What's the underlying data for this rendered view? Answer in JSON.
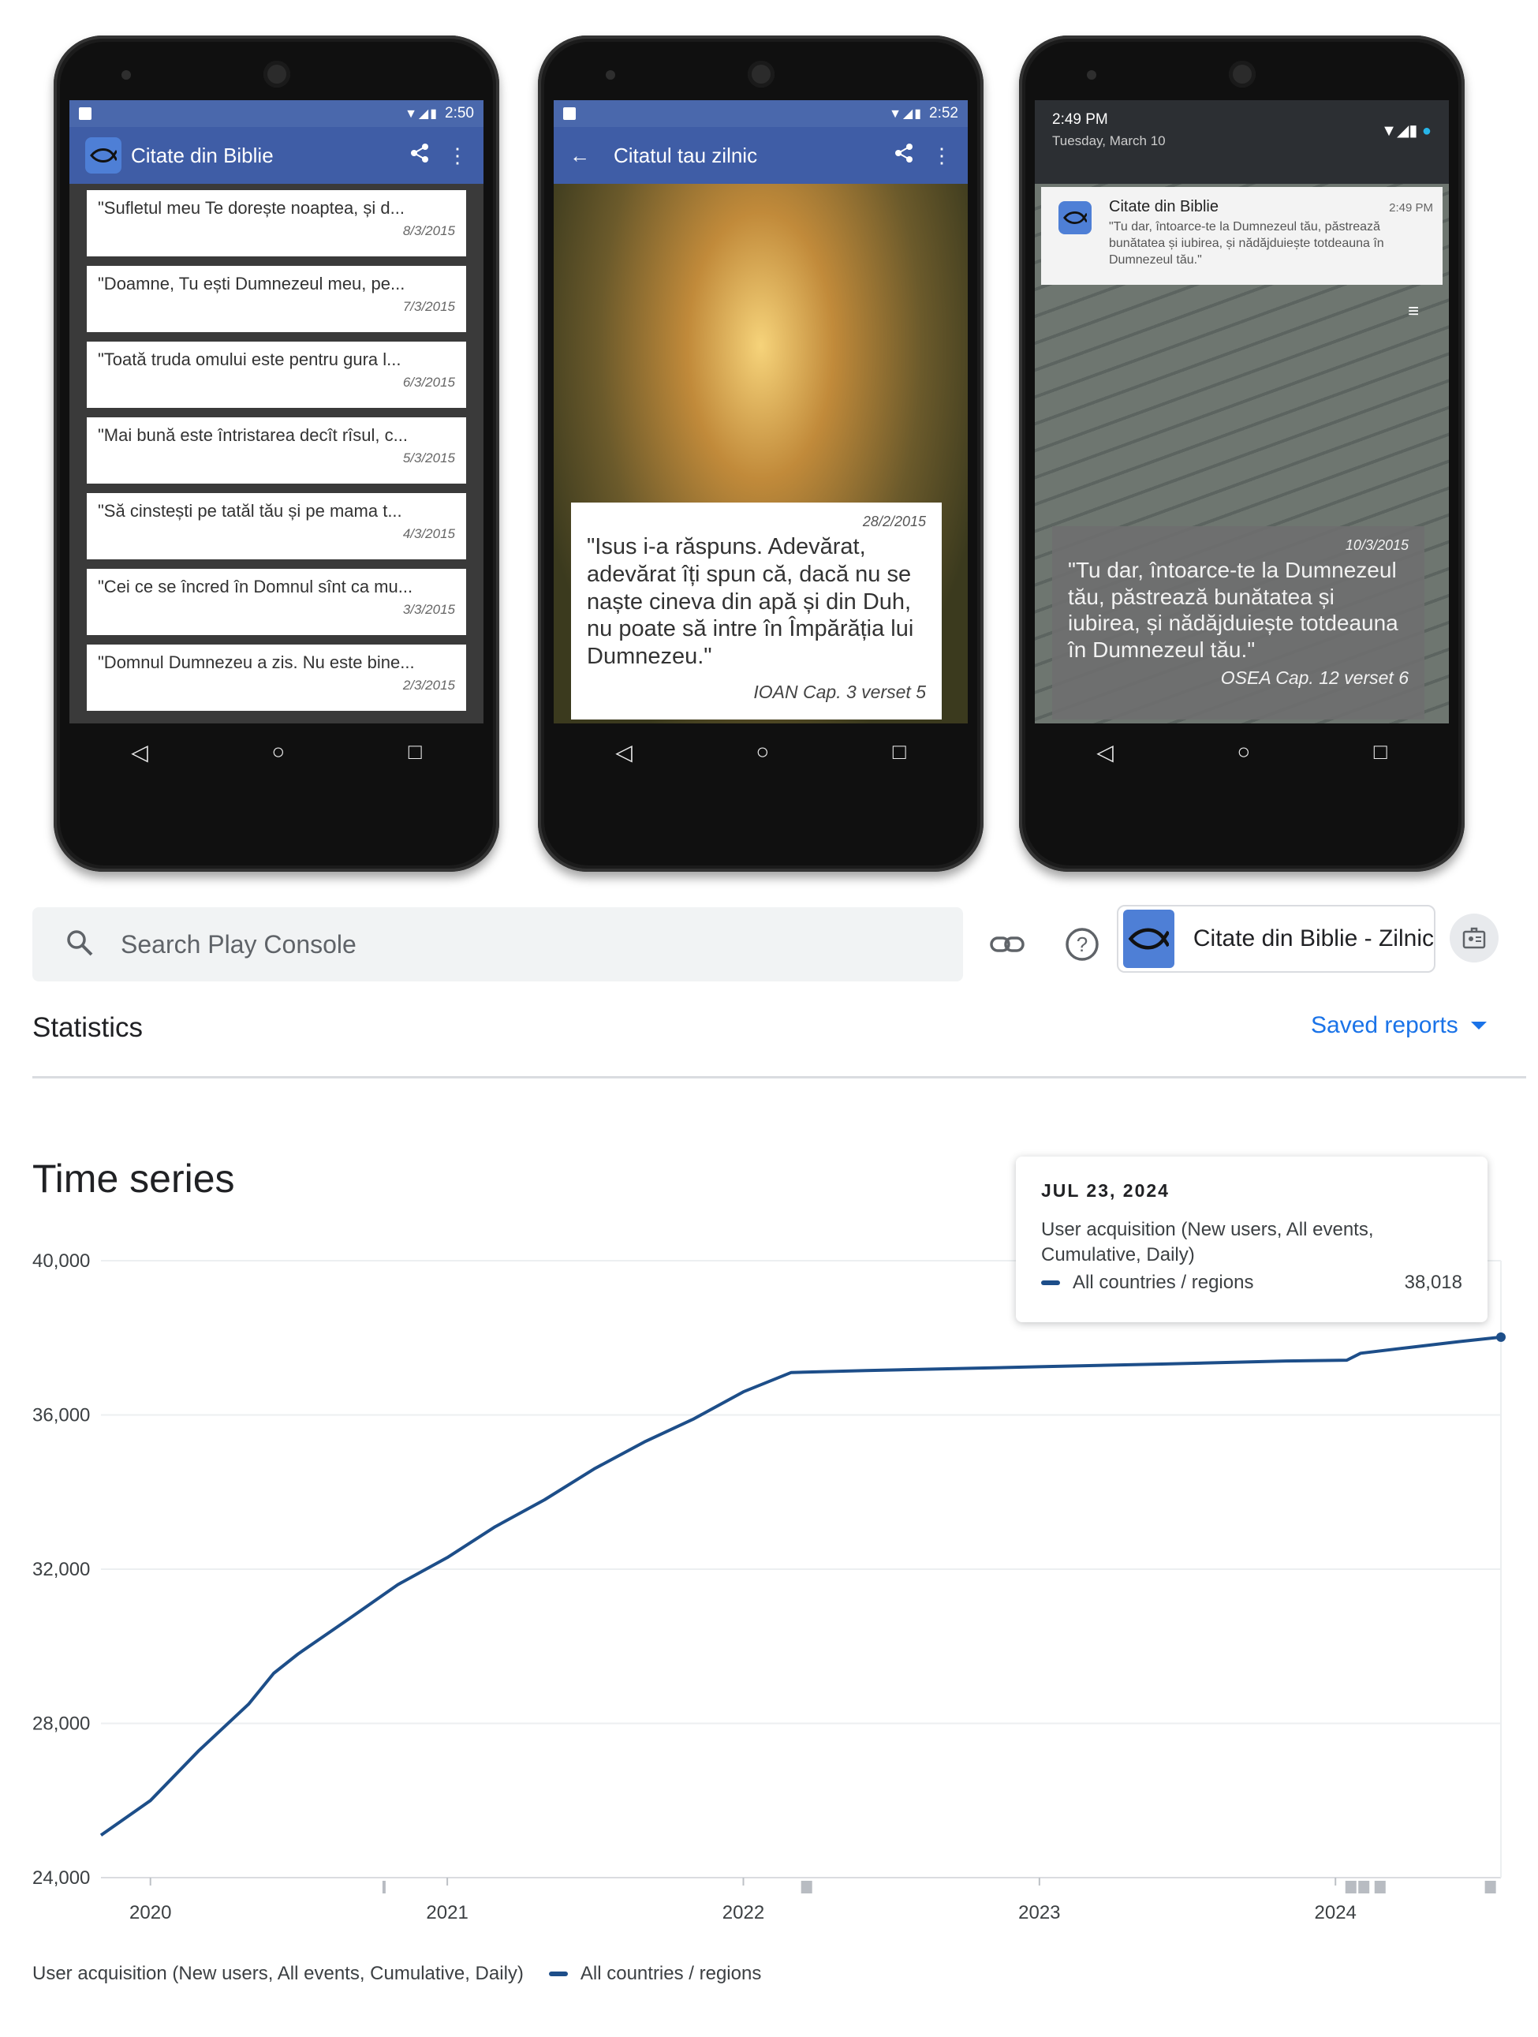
{
  "phone1": {
    "status_time": "2:50",
    "app_title": "Citate din Biblie",
    "quotes": [
      {
        "text": "\"Sufletul meu Te dorește noaptea, și d...",
        "date": "8/3/2015"
      },
      {
        "text": "\"Doamne, Tu ești Dumnezeul meu, pe...",
        "date": "7/3/2015"
      },
      {
        "text": "\"Toată truda omului este pentru gura l...",
        "date": "6/3/2015"
      },
      {
        "text": "\"Mai bună este întristarea decît rîsul, c...",
        "date": "5/3/2015"
      },
      {
        "text": "\"Să cinstești pe tatăl tău și pe mama t...",
        "date": "4/3/2015"
      },
      {
        "text": "\"Cei ce se încred în Domnul sînt ca mu...",
        "date": "3/3/2015"
      },
      {
        "text": "\"Domnul Dumnezeu a zis. Nu este bine...",
        "date": "2/3/2015"
      }
    ]
  },
  "phone2": {
    "status_time": "2:52",
    "title": "Citatul tau zilnic",
    "date": "28/2/2015",
    "quote": "\"Isus i-a răspuns. Adevărat, adevărat îți spun că, dacă nu se naște cineva din apă și din Duh, nu poate să intre în Împărăția lui Dumnezeu.\"",
    "reference": "IOAN Cap. 3 verset 5"
  },
  "phone3": {
    "time": "2:49 PM",
    "date": "Tuesday, March 10",
    "notif_app": "Citate din Biblie",
    "notif_time": "2:49 PM",
    "notif_text": "\"Tu dar, întoarce-te la Dumnezeul tău, păstrează bunătatea și iubirea, și nădăjduiește totdeauna în Dumnezeul tău.\"",
    "card_date": "10/3/2015",
    "card_quote": "\"Tu dar, întoarce-te la Dumnezeul tău, păstrează bunătatea și iubirea, și nădăjduiește totdeauna în Dumnezeul tău.\"",
    "card_reference": "OSEA Cap. 12 verset 6"
  },
  "console": {
    "search_placeholder": "Search Play Console",
    "app_name": "Citate din Biblie - Zilnic",
    "section_title": "Statistics",
    "saved_reports": "Saved reports",
    "chart_title": "Time series"
  },
  "tooltip": {
    "date": "JUL 23, 2024",
    "metric": "User acquisition (New users, All events, Cumulative, Daily)",
    "series": "All countries / regions",
    "value": "38,018"
  },
  "legend": {
    "metric": "User acquisition (New users, All events, Cumulative, Daily)",
    "series": "All countries / regions"
  },
  "colors": {
    "line": "#1d4e89",
    "accent": "#1a73e8",
    "app_bar": "#3f5da6"
  },
  "chart_data": {
    "type": "line",
    "ylim": [
      24000,
      40000
    ],
    "yticks": [
      "24,000",
      "28,000",
      "32,000",
      "36,000",
      "40,000"
    ],
    "xticks": [
      "2020",
      "2021",
      "2022",
      "2023",
      "2024"
    ],
    "series": [
      {
        "name": "All countries / regions",
        "points": [
          [
            "2019-11-01",
            25100
          ],
          [
            "2020-01-01",
            26000
          ],
          [
            "2020-03-01",
            27300
          ],
          [
            "2020-05-01",
            28500
          ],
          [
            "2020-06-01",
            29300
          ],
          [
            "2020-07-01",
            29800
          ],
          [
            "2020-09-01",
            30700
          ],
          [
            "2020-11-01",
            31600
          ],
          [
            "2021-01-01",
            32300
          ],
          [
            "2021-03-01",
            33100
          ],
          [
            "2021-05-01",
            33800
          ],
          [
            "2021-07-01",
            34600
          ],
          [
            "2021-09-01",
            35300
          ],
          [
            "2021-11-01",
            35900
          ],
          [
            "2022-01-01",
            36600
          ],
          [
            "2022-03-01",
            37100
          ],
          [
            "2022-06-01",
            37150
          ],
          [
            "2023-01-01",
            37250
          ],
          [
            "2023-06-01",
            37320
          ],
          [
            "2023-11-01",
            37400
          ],
          [
            "2024-01-15",
            37420
          ],
          [
            "2024-02-01",
            37600
          ],
          [
            "2024-04-01",
            37750
          ],
          [
            "2024-06-01",
            37900
          ],
          [
            "2024-07-23",
            38018
          ]
        ]
      }
    ]
  }
}
